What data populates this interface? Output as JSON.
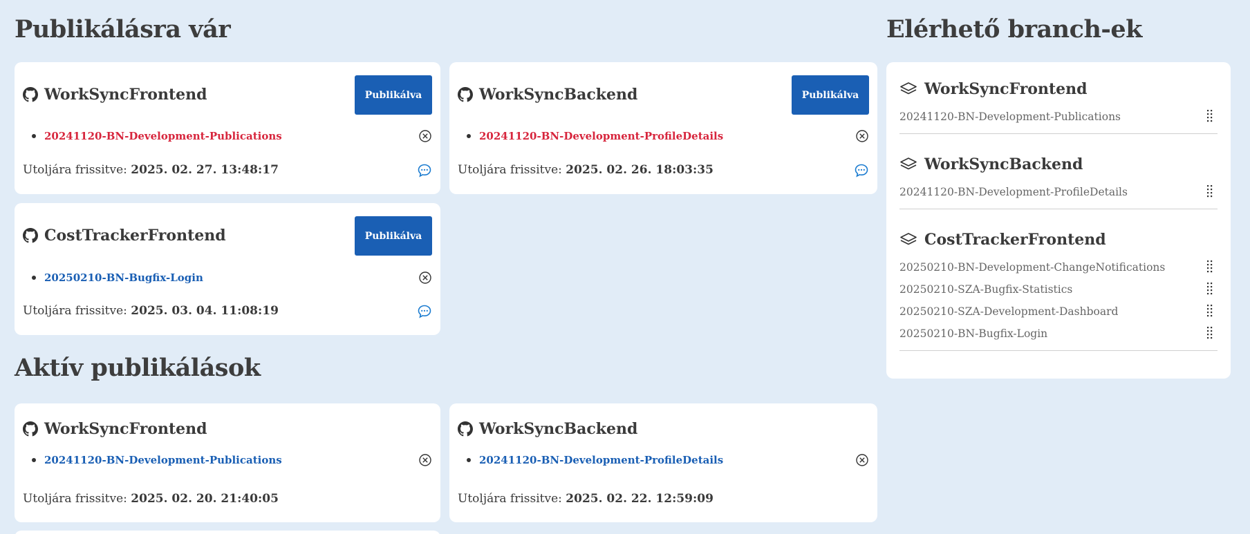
{
  "pending": {
    "title": "Publikálásra vár",
    "publish_label": "Publikálva",
    "updated_label": "Utoljára frissitve:",
    "cards": [
      {
        "repo": "WorkSyncFrontend",
        "branch": "20241120-BN-Development-Publications",
        "branch_color": "#d7263d",
        "updated": "2025. 02. 27. 13:48:17"
      },
      {
        "repo": "WorkSyncBackend",
        "branch": "20241120-BN-Development-ProfileDetails",
        "branch_color": "#d7263d",
        "updated": "2025. 02. 26. 18:03:35"
      },
      {
        "repo": "CostTrackerFrontend",
        "branch": "20250210-BN-Bugfix-Login",
        "branch_color": "#1a5fb4",
        "updated": "2025. 03. 04. 11:08:19"
      }
    ]
  },
  "active": {
    "title": "Aktív publikálások",
    "updated_label": "Utoljára frissitve:",
    "cards": [
      {
        "repo": "WorkSyncFrontend",
        "branch": "20241120-BN-Development-Publications",
        "branch_color": "#1a5fb4",
        "updated": "2025. 02. 20. 21:40:05"
      },
      {
        "repo": "WorkSyncBackend",
        "branch": "20241120-BN-Development-ProfileDetails",
        "branch_color": "#1a5fb4",
        "updated": "2025. 02. 22. 12:59:09"
      }
    ]
  },
  "available": {
    "title": "Elérhető branch-ek",
    "groups": [
      {
        "repo": "WorkSyncFrontend",
        "branches": [
          "20241120-BN-Development-Publications"
        ]
      },
      {
        "repo": "WorkSyncBackend",
        "branches": [
          "20241120-BN-Development-ProfileDetails"
        ]
      },
      {
        "repo": "CostTrackerFrontend",
        "branches": [
          "20250210-BN-Development-ChangeNotifications",
          "20250210-SZA-Bugfix-Statistics",
          "20250210-SZA-Development-Dashboard",
          "20250210-BN-Bugfix-Login"
        ]
      }
    ]
  },
  "icons": {
    "repo": "github-icon",
    "remove": "close-circle-icon",
    "comment": "comment-icon",
    "group": "layers-icon",
    "drag": "drag-handle-icon"
  },
  "colors": {
    "background": "#e1ecf7",
    "primary": "#1a5fb4",
    "danger": "#d7263d"
  }
}
